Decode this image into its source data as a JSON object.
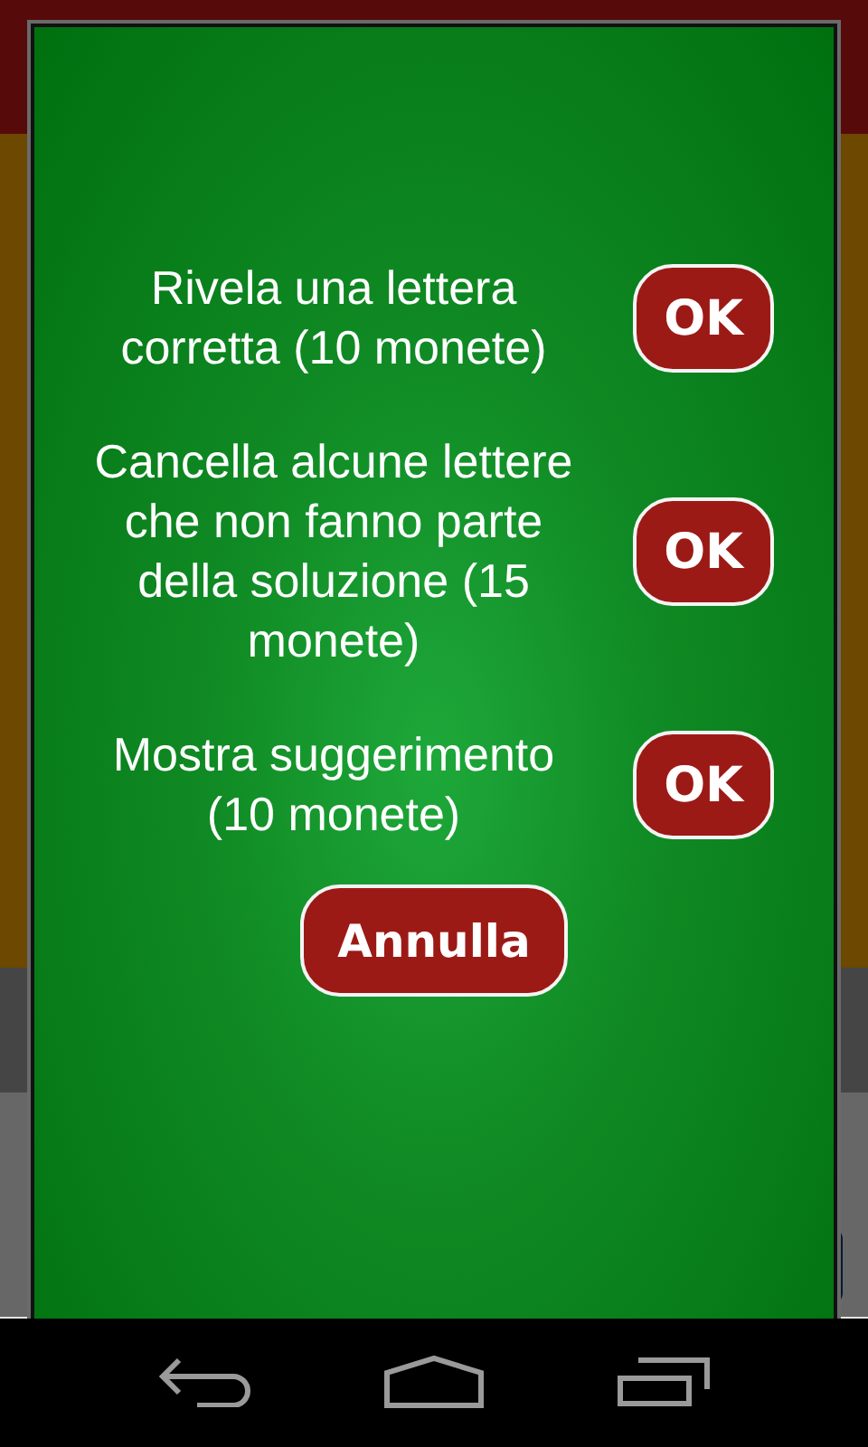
{
  "dialog": {
    "options": [
      {
        "text": "Rivela una lettera corretta (10 monete)",
        "button": "OK"
      },
      {
        "text": "Cancella alcune lettere che non fanno parte della soluzione (15 monete)",
        "button": "OK"
      },
      {
        "text": "Mostra suggerimento (10 monete)",
        "button": "OK"
      }
    ],
    "cancel_button": "Annulla"
  }
}
